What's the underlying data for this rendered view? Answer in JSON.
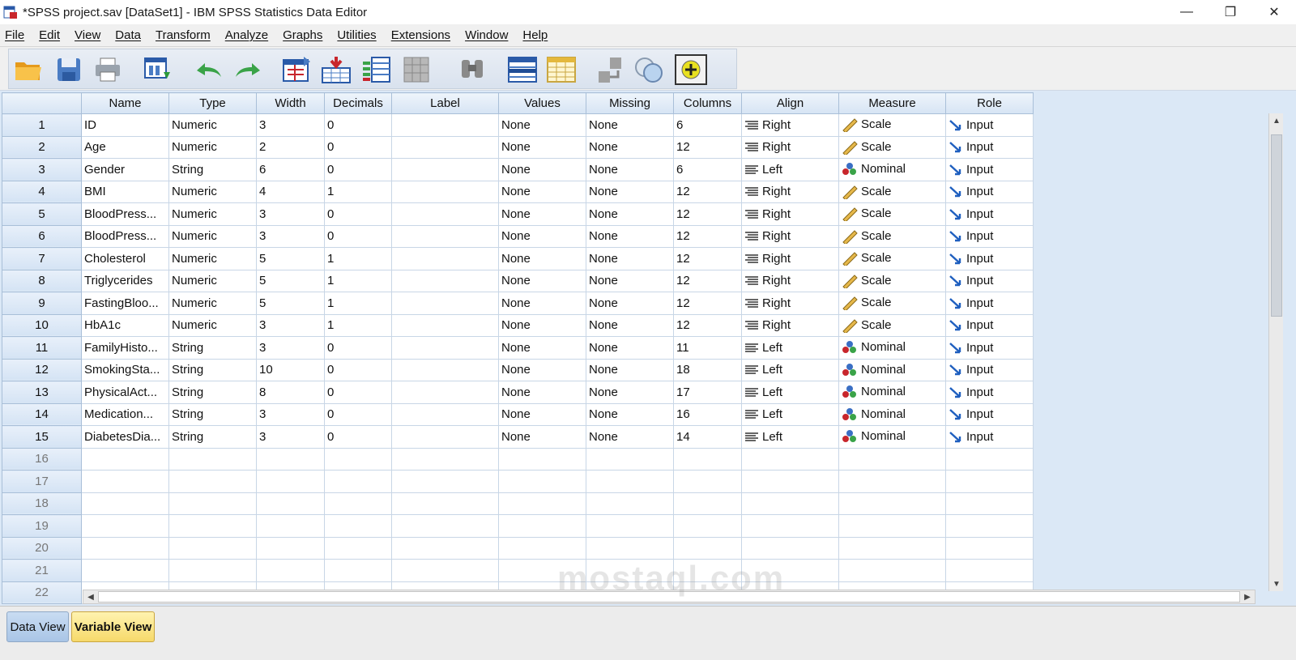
{
  "window": {
    "title": "*SPSS project.sav [DataSet1] - IBM SPSS Statistics Data Editor",
    "minimize": "—",
    "maximize": "❐",
    "close": "✕"
  },
  "menu": [
    "File",
    "Edit",
    "View",
    "Data",
    "Transform",
    "Analyze",
    "Graphs",
    "Utilities",
    "Extensions",
    "Window",
    "Help"
  ],
  "toolbar_icons": [
    "open-icon",
    "save-icon",
    "print-icon",
    "recall-dialog-icon",
    "undo-icon",
    "redo-icon",
    "goto-case-icon",
    "goto-variable-icon",
    "variables-icon",
    "run-descriptive-icon",
    "find-icon",
    "insert-cases-icon",
    "insert-variable-icon",
    "split-file-icon",
    "value-labels-icon",
    "use-sets-icon",
    "spelling-icon"
  ],
  "columns": [
    "Name",
    "Type",
    "Width",
    "Decimals",
    "Label",
    "Values",
    "Missing",
    "Columns",
    "Align",
    "Measure",
    "Role"
  ],
  "rows": [
    {
      "n": "1",
      "name": "ID",
      "type": "Numeric",
      "width": "3",
      "decimals": "0",
      "label": "",
      "values": "None",
      "missing": "None",
      "columns": "6",
      "align": "Right",
      "measure": "Scale",
      "role": "Input"
    },
    {
      "n": "2",
      "name": "Age",
      "type": "Numeric",
      "width": "2",
      "decimals": "0",
      "label": "",
      "values": "None",
      "missing": "None",
      "columns": "12",
      "align": "Right",
      "measure": "Scale",
      "role": "Input"
    },
    {
      "n": "3",
      "name": "Gender",
      "type": "String",
      "width": "6",
      "decimals": "0",
      "label": "",
      "values": "None",
      "missing": "None",
      "columns": "6",
      "align": "Left",
      "measure": "Nominal",
      "role": "Input"
    },
    {
      "n": "4",
      "name": "BMI",
      "type": "Numeric",
      "width": "4",
      "decimals": "1",
      "label": "",
      "values": "None",
      "missing": "None",
      "columns": "12",
      "align": "Right",
      "measure": "Scale",
      "role": "Input"
    },
    {
      "n": "5",
      "name": "BloodPress...",
      "type": "Numeric",
      "width": "3",
      "decimals": "0",
      "label": "",
      "values": "None",
      "missing": "None",
      "columns": "12",
      "align": "Right",
      "measure": "Scale",
      "role": "Input"
    },
    {
      "n": "6",
      "name": "BloodPress...",
      "type": "Numeric",
      "width": "3",
      "decimals": "0",
      "label": "",
      "values": "None",
      "missing": "None",
      "columns": "12",
      "align": "Right",
      "measure": "Scale",
      "role": "Input"
    },
    {
      "n": "7",
      "name": "Cholesterol",
      "type": "Numeric",
      "width": "5",
      "decimals": "1",
      "label": "",
      "values": "None",
      "missing": "None",
      "columns": "12",
      "align": "Right",
      "measure": "Scale",
      "role": "Input"
    },
    {
      "n": "8",
      "name": "Triglycerides",
      "type": "Numeric",
      "width": "5",
      "decimals": "1",
      "label": "",
      "values": "None",
      "missing": "None",
      "columns": "12",
      "align": "Right",
      "measure": "Scale",
      "role": "Input"
    },
    {
      "n": "9",
      "name": "FastingBloo...",
      "type": "Numeric",
      "width": "5",
      "decimals": "1",
      "label": "",
      "values": "None",
      "missing": "None",
      "columns": "12",
      "align": "Right",
      "measure": "Scale",
      "role": "Input"
    },
    {
      "n": "10",
      "name": "HbA1c",
      "type": "Numeric",
      "width": "3",
      "decimals": "1",
      "label": "",
      "values": "None",
      "missing": "None",
      "columns": "12",
      "align": "Right",
      "measure": "Scale",
      "role": "Input"
    },
    {
      "n": "11",
      "name": "FamilyHisto...",
      "type": "String",
      "width": "3",
      "decimals": "0",
      "label": "",
      "values": "None",
      "missing": "None",
      "columns": "11",
      "align": "Left",
      "measure": "Nominal",
      "role": "Input"
    },
    {
      "n": "12",
      "name": "SmokingSta...",
      "type": "String",
      "width": "10",
      "decimals": "0",
      "label": "",
      "values": "None",
      "missing": "None",
      "columns": "18",
      "align": "Left",
      "measure": "Nominal",
      "role": "Input"
    },
    {
      "n": "13",
      "name": "PhysicalAct...",
      "type": "String",
      "width": "8",
      "decimals": "0",
      "label": "",
      "values": "None",
      "missing": "None",
      "columns": "17",
      "align": "Left",
      "measure": "Nominal",
      "role": "Input"
    },
    {
      "n": "14",
      "name": "Medication...",
      "type": "String",
      "width": "3",
      "decimals": "0",
      "label": "",
      "values": "None",
      "missing": "None",
      "columns": "16",
      "align": "Left",
      "measure": "Nominal",
      "role": "Input"
    },
    {
      "n": "15",
      "name": "DiabetesDia...",
      "type": "String",
      "width": "3",
      "decimals": "0",
      "label": "",
      "values": "None",
      "missing": "None",
      "columns": "14",
      "align": "Left",
      "measure": "Nominal",
      "role": "Input"
    }
  ],
  "empty_rows": [
    "16",
    "17",
    "18",
    "19",
    "20",
    "21",
    "22"
  ],
  "tabs": {
    "data_view": "Data View",
    "variable_view": "Variable View"
  },
  "watermark": "mostaql.com",
  "colors": {
    "header_bg": "#d6e4f4",
    "active_tab": "#f6d96a",
    "inactive_tab": "#a9c5e6"
  }
}
